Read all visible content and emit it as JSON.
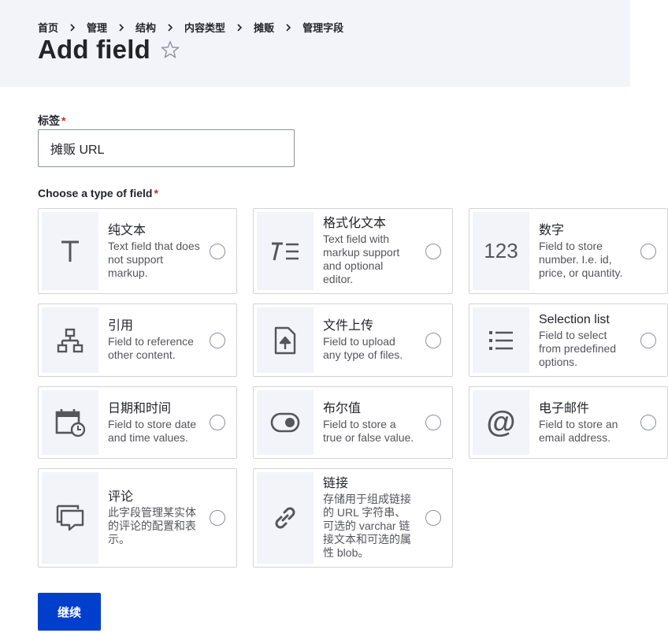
{
  "breadcrumb": [
    "首页",
    "管理",
    "结构",
    "内容类型",
    "摊贩",
    "管理字段"
  ],
  "page_title": "Add field",
  "label_field": {
    "label": "标签",
    "required_marker": "*",
    "value": "摊贩 URL"
  },
  "type_field": {
    "label": "Choose a type of field",
    "required_marker": "*"
  },
  "field_types": [
    {
      "id": "plain-text",
      "icon": "text-T-icon",
      "title": "纯文本",
      "desc": "Text field that does not support markup."
    },
    {
      "id": "formatted-text",
      "icon": "formatted-text-icon",
      "title": "格式化文本",
      "desc": "Text field with markup support and optional editor."
    },
    {
      "id": "number",
      "icon": "number-123-icon",
      "icon_text": "123",
      "title": "数字",
      "desc": "Field to store number. I.e. id, price, or quantity."
    },
    {
      "id": "reference",
      "icon": "hierarchy-icon",
      "title": "引用",
      "desc": "Field to reference other content."
    },
    {
      "id": "file-upload",
      "icon": "file-upload-icon",
      "title": "文件上传",
      "desc": "Field to upload any type of files."
    },
    {
      "id": "selection-list",
      "icon": "list-icon",
      "title": "Selection list",
      "desc": "Field to select from predefined options."
    },
    {
      "id": "datetime",
      "icon": "calendar-clock-icon",
      "title": "日期和时间",
      "desc": "Field to store date and time values."
    },
    {
      "id": "boolean",
      "icon": "toggle-icon",
      "title": "布尔值",
      "desc": "Field to store a true or false value."
    },
    {
      "id": "email",
      "icon": "at-icon",
      "icon_text": "@",
      "title": "电子邮件",
      "desc": "Field to store an email address."
    },
    {
      "id": "comment",
      "icon": "comment-icon",
      "title": "评论",
      "desc": "此字段管理某实体的评论的配置和表示。"
    },
    {
      "id": "link",
      "icon": "link-icon",
      "title": "链接",
      "desc": "存储用于组成链接的 URL 字符串、可选的 varchar 链接文本和可选的属性 blob。"
    }
  ],
  "continue_label": "继续",
  "colors": {
    "header_bg": "#f3f4f9",
    "primary_button": "#003ecc",
    "required": "#d72222",
    "icon": "#55565b"
  }
}
